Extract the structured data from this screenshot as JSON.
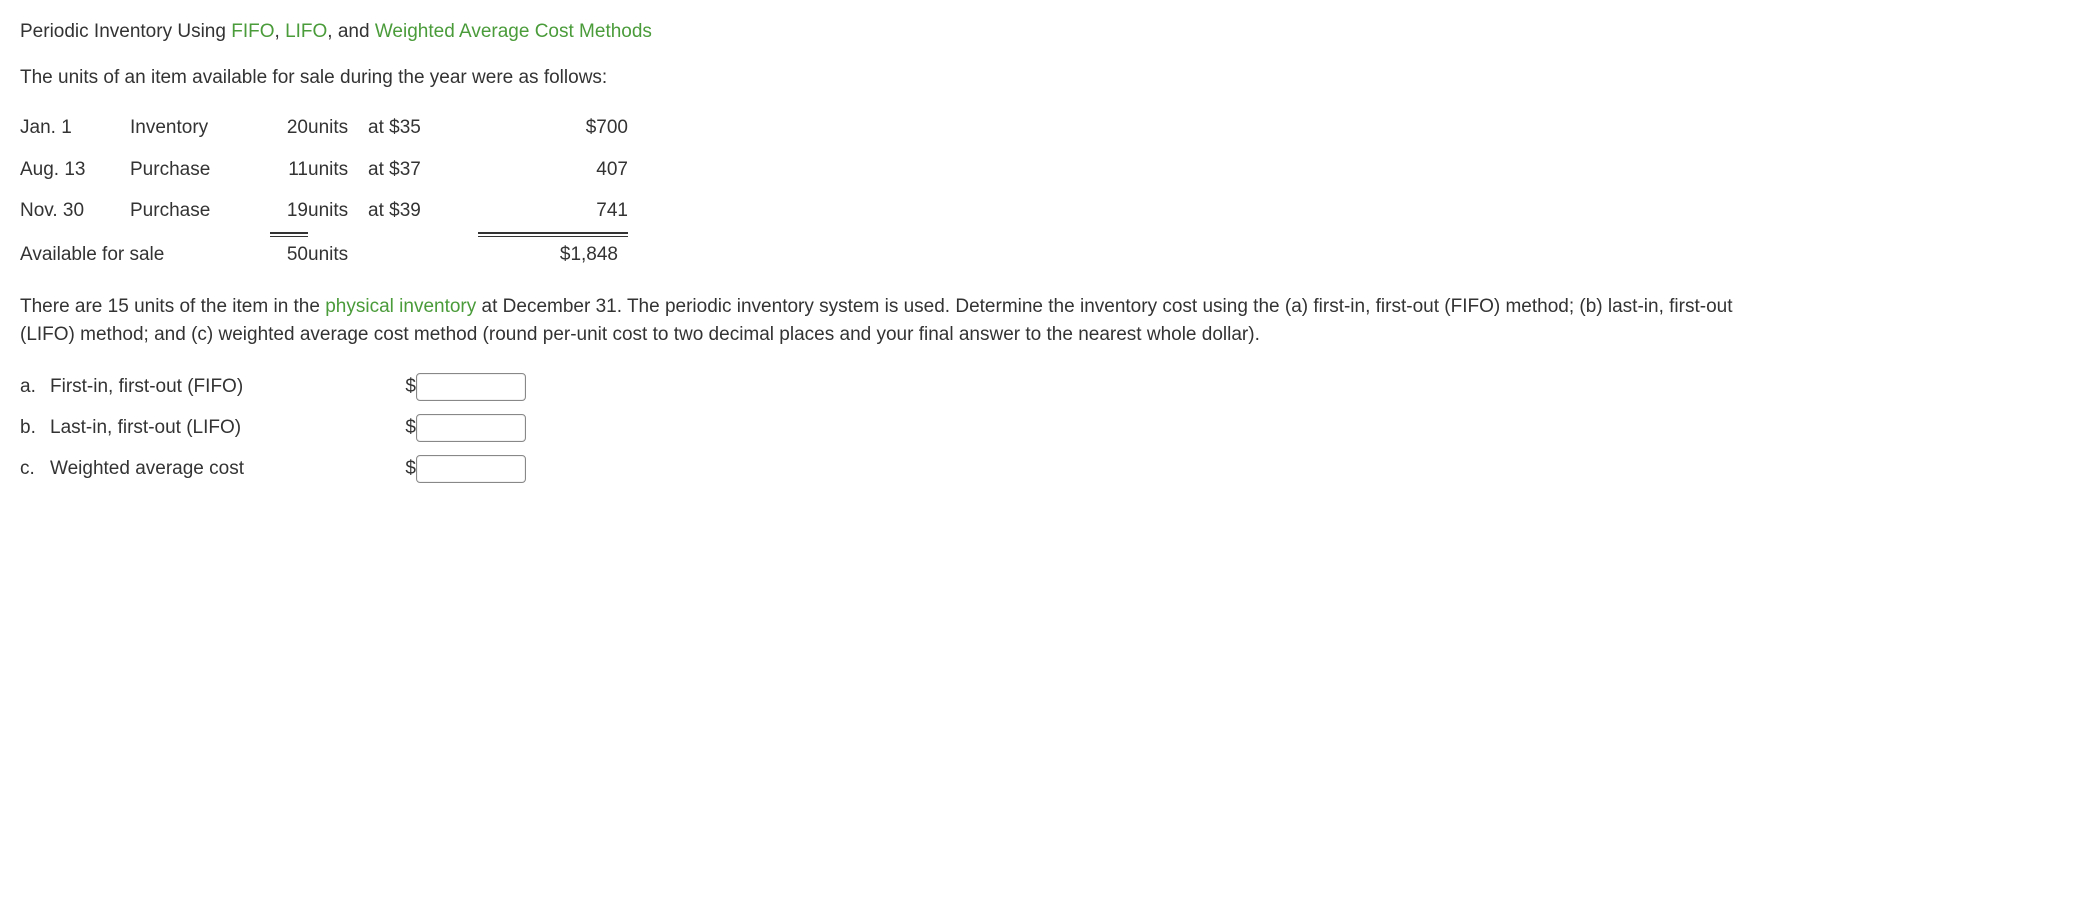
{
  "title": {
    "pre1": "Periodic Inventory Using ",
    "link1": "FIFO",
    "sep1": ", ",
    "link2": "LIFO",
    "sep2": ", and ",
    "link3": "Weighted Average Cost Methods"
  },
  "intro": "The units of an item available for sale during the year were as follows:",
  "inv": {
    "rows": [
      {
        "date": "Jan. 1",
        "type": "Inventory",
        "units": "20",
        "unitLbl": "units",
        "at": "at $35",
        "amount": "$700"
      },
      {
        "date": "Aug. 13",
        "type": "Purchase",
        "units": "11",
        "unitLbl": "units",
        "at": "at $37",
        "amount": "407"
      },
      {
        "date": "Nov. 30",
        "type": "Purchase",
        "units": "19",
        "unitLbl": "units",
        "at": "at $39",
        "amount": "741"
      }
    ],
    "total": {
      "label": "Available for sale",
      "units": "50",
      "unitLbl": "units",
      "amount": "$1,848"
    }
  },
  "para": {
    "t1": "There are 15 units of the item in the ",
    "link": "physical inventory",
    "t2": " at December 31. The periodic inventory system is used. Determine the inventory cost using the (a) first-in, first-out (FIFO) method; (b) last-in, first-out (LIFO) method; and (c) weighted average cost method (round per-unit cost to two decimal places and your final answer to the nearest whole dollar)."
  },
  "answers": [
    {
      "lbl": "a.",
      "method": "First-in, first-out (FIFO)",
      "cur": "$"
    },
    {
      "lbl": "b.",
      "method": "Last-in, first-out (LIFO)",
      "cur": "$"
    },
    {
      "lbl": "c.",
      "method": "Weighted average cost",
      "cur": "$"
    }
  ]
}
